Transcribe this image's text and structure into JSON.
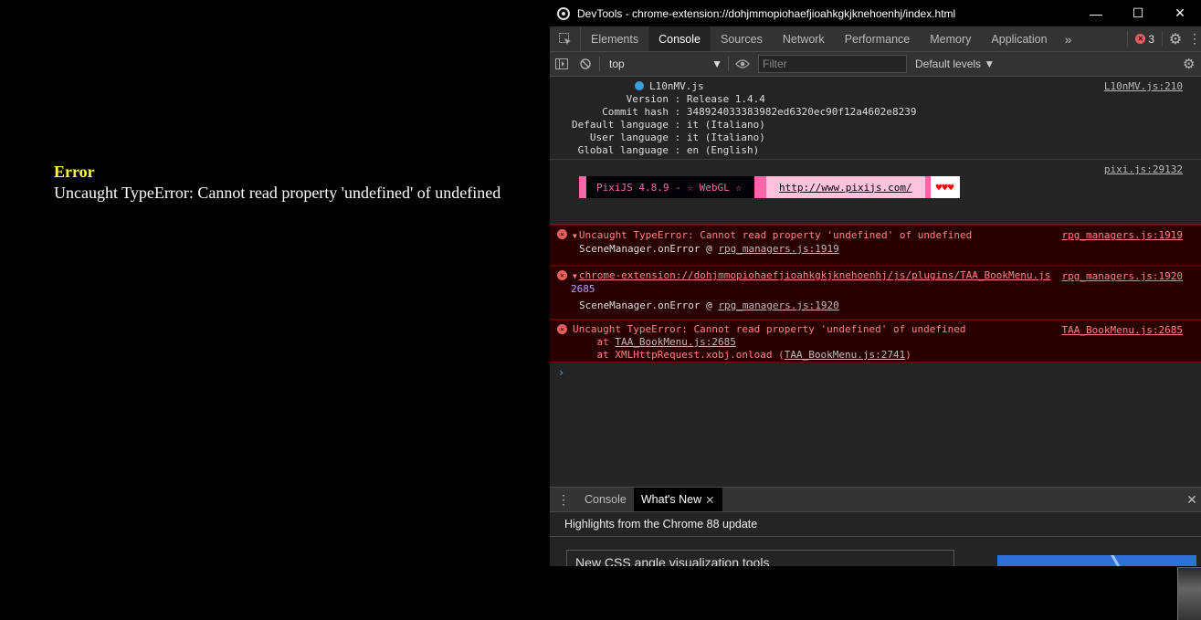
{
  "game": {
    "error_title": "Error",
    "error_message": "Uncaught TypeError: Cannot read property 'undefined' of undefined"
  },
  "window": {
    "title": "DevTools - chrome-extension://dohjmmopiohaefjioahkgkjknehoenhj/index.html",
    "minimize": "—",
    "maximize": "☐",
    "close": "✕"
  },
  "tabs": [
    "Elements",
    "Console",
    "Sources",
    "Network",
    "Performance",
    "Memory",
    "Application"
  ],
  "active_tab": "Console",
  "more_tabs": "»",
  "error_count": "3",
  "toolbar": {
    "context": "top",
    "filter_placeholder": "Filter",
    "levels": "Default levels ▼"
  },
  "console": {
    "info_source": "L10nMV.js:210",
    "info_lines": {
      "title": "L10nMV.js",
      "version": "         Version : Release 1.4.4",
      "commit": "     Commit hash : 348924033383982ed6320ec90f12a4602e8239",
      "default_lang": "Default language : it (Italiano)",
      "user_lang": "   User language : it (Italiano)",
      "global_lang": " Global language : en (English)"
    },
    "pixi_source": "pixi.js:29132",
    "pixi_text": "PixiJS 4.8.9 - ☆ WebGL ☆",
    "pixi_url": "http://www.pixijs.com/",
    "pixi_hearts": "♥♥♥",
    "err1": {
      "message": "Uncaught TypeError: Cannot read property 'undefined' of undefined",
      "source": "rpg_managers.js:1919",
      "stack_fn": "SceneManager.onError @ ",
      "stack_link": "rpg_managers.js:1919"
    },
    "err2": {
      "url": "chrome-extension://dohjmmopiohaefjioahkgkjknehoenhj/js/plugins/TAA_BookMenu.js",
      "line": "2685",
      "source": "rpg_managers.js:1920",
      "stack_fn": "SceneManager.onError @ ",
      "stack_link": "rpg_managers.js:1920"
    },
    "err3": {
      "message": "Uncaught TypeError: Cannot read property 'undefined' of undefined",
      "source": "TAA_BookMenu.js:2685",
      "trace1_prefix": "    at ",
      "trace1_link": "TAA_BookMenu.js:2685",
      "trace2_prefix": "    at XMLHttpRequest.xobj.onload (",
      "trace2_link": "TAA_BookMenu.js:2741",
      "trace2_suffix": ")"
    },
    "prompt": "›"
  },
  "drawer": {
    "tabs": [
      "Console",
      "What's New"
    ],
    "close_tab": "✕",
    "close_drawer": "✕",
    "heading": "Highlights from the Chrome 88 update",
    "feature_title": "New CSS angle visualization tools"
  }
}
